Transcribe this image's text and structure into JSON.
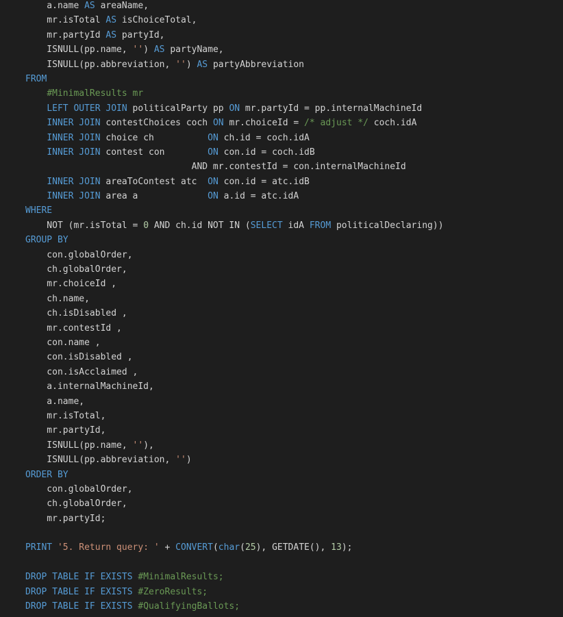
{
  "colors": {
    "background": "#1e1e1e",
    "text": "#d4d4d4",
    "keyword": "#569cd6",
    "string": "#ce9178",
    "comment": "#6a9955",
    "number": "#b5cea8"
  },
  "code_lines": [
    [
      [
        "txt",
        "    a.name "
      ],
      [
        "kw",
        "AS"
      ],
      [
        "txt",
        " areaName,"
      ]
    ],
    [
      [
        "txt",
        "    mr.isTotal "
      ],
      [
        "kw",
        "AS"
      ],
      [
        "txt",
        " isChoiceTotal,"
      ]
    ],
    [
      [
        "txt",
        "    mr.partyId "
      ],
      [
        "kw",
        "AS"
      ],
      [
        "txt",
        " partyId,"
      ]
    ],
    [
      [
        "txt",
        "    ISNULL(pp.name, "
      ],
      [
        "str",
        "''"
      ],
      [
        "txt",
        ") "
      ],
      [
        "kw",
        "AS"
      ],
      [
        "txt",
        " partyName,"
      ]
    ],
    [
      [
        "txt",
        "    ISNULL(pp.abbreviation, "
      ],
      [
        "str",
        "''"
      ],
      [
        "txt",
        ") "
      ],
      [
        "kw",
        "AS"
      ],
      [
        "txt",
        " partyAbbreviation"
      ]
    ],
    [
      [
        "kw",
        "FROM"
      ]
    ],
    [
      [
        "txt",
        "    "
      ],
      [
        "com",
        "#MinimalResults mr"
      ]
    ],
    [
      [
        "txt",
        "    "
      ],
      [
        "kw",
        "LEFT OUTER JOIN"
      ],
      [
        "txt",
        " politicalParty pp "
      ],
      [
        "kw",
        "ON"
      ],
      [
        "txt",
        " mr.partyId = pp.internalMachineId"
      ]
    ],
    [
      [
        "txt",
        "    "
      ],
      [
        "kw",
        "INNER JOIN"
      ],
      [
        "txt",
        " contestChoices coch "
      ],
      [
        "kw",
        "ON"
      ],
      [
        "txt",
        " mr.choiceId = "
      ],
      [
        "com",
        "/* adjust */"
      ],
      [
        "txt",
        " coch.idA"
      ]
    ],
    [
      [
        "txt",
        "    "
      ],
      [
        "kw",
        "INNER JOIN"
      ],
      [
        "txt",
        " choice ch          "
      ],
      [
        "kw",
        "ON"
      ],
      [
        "txt",
        " ch.id = coch.idA"
      ]
    ],
    [
      [
        "txt",
        "    "
      ],
      [
        "kw",
        "INNER JOIN"
      ],
      [
        "txt",
        " contest con        "
      ],
      [
        "kw",
        "ON"
      ],
      [
        "txt",
        " con.id = coch.idB"
      ]
    ],
    [
      [
        "txt",
        "                               AND mr.contestId = con.internalMachineId"
      ]
    ],
    [
      [
        "txt",
        "    "
      ],
      [
        "kw",
        "INNER JOIN"
      ],
      [
        "txt",
        " areaToContest atc  "
      ],
      [
        "kw",
        "ON"
      ],
      [
        "txt",
        " con.id = atc.idB"
      ]
    ],
    [
      [
        "txt",
        "    "
      ],
      [
        "kw",
        "INNER JOIN"
      ],
      [
        "txt",
        " area a             "
      ],
      [
        "kw",
        "ON"
      ],
      [
        "txt",
        " a.id = atc.idA"
      ]
    ],
    [
      [
        "kw",
        "WHERE"
      ]
    ],
    [
      [
        "txt",
        "    NOT (mr.isTotal = "
      ],
      [
        "num",
        "0"
      ],
      [
        "txt",
        " AND ch.id NOT IN ("
      ],
      [
        "kw",
        "SELECT"
      ],
      [
        "txt",
        " idA "
      ],
      [
        "kw",
        "FROM"
      ],
      [
        "txt",
        " politicalDeclaring))"
      ]
    ],
    [
      [
        "kw",
        "GROUP BY"
      ]
    ],
    [
      [
        "txt",
        "    con.globalOrder,"
      ]
    ],
    [
      [
        "txt",
        "    ch.globalOrder,"
      ]
    ],
    [
      [
        "txt",
        "    mr.choiceId ,"
      ]
    ],
    [
      [
        "txt",
        "    ch.name,"
      ]
    ],
    [
      [
        "txt",
        "    ch.isDisabled ,"
      ]
    ],
    [
      [
        "txt",
        "    mr.contestId ,"
      ]
    ],
    [
      [
        "txt",
        "    con.name ,"
      ]
    ],
    [
      [
        "txt",
        "    con.isDisabled ,"
      ]
    ],
    [
      [
        "txt",
        "    con.isAcclaimed ,"
      ]
    ],
    [
      [
        "txt",
        "    a.internalMachineId,"
      ]
    ],
    [
      [
        "txt",
        "    a.name,"
      ]
    ],
    [
      [
        "txt",
        "    mr.isTotal,"
      ]
    ],
    [
      [
        "txt",
        "    mr.partyId,"
      ]
    ],
    [
      [
        "txt",
        "    ISNULL(pp.name, "
      ],
      [
        "str",
        "''"
      ],
      [
        "txt",
        "),"
      ]
    ],
    [
      [
        "txt",
        "    ISNULL(pp.abbreviation, "
      ],
      [
        "str",
        "''"
      ],
      [
        "txt",
        ")"
      ]
    ],
    [
      [
        "kw",
        "ORDER BY"
      ]
    ],
    [
      [
        "txt",
        "    con.globalOrder,"
      ]
    ],
    [
      [
        "txt",
        "    ch.globalOrder,"
      ]
    ],
    [
      [
        "txt",
        "    mr.partyId;"
      ]
    ],
    [],
    [
      [
        "kw",
        "PRINT"
      ],
      [
        "txt",
        " "
      ],
      [
        "str",
        "'5. Return query: '"
      ],
      [
        "txt",
        " + "
      ],
      [
        "kw",
        "CONVERT"
      ],
      [
        "txt",
        "("
      ],
      [
        "kw",
        "char"
      ],
      [
        "txt",
        "("
      ],
      [
        "num",
        "25"
      ],
      [
        "txt",
        "), GETDATE(), "
      ],
      [
        "num",
        "13"
      ],
      [
        "txt",
        ");"
      ]
    ],
    [],
    [
      [
        "kw",
        "DROP TABLE IF EXISTS"
      ],
      [
        "txt",
        " "
      ],
      [
        "com",
        "#MinimalResults;"
      ]
    ],
    [
      [
        "kw",
        "DROP TABLE IF EXISTS"
      ],
      [
        "txt",
        " "
      ],
      [
        "com",
        "#ZeroResults;"
      ]
    ],
    [
      [
        "kw",
        "DROP TABLE IF EXISTS"
      ],
      [
        "txt",
        " "
      ],
      [
        "com",
        "#QualifyingBallots;"
      ]
    ]
  ]
}
